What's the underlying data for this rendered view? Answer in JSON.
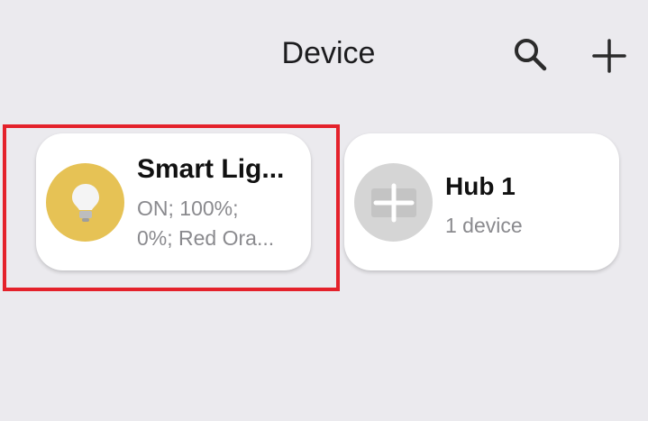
{
  "header": {
    "title": "Device"
  },
  "devices": [
    {
      "name": "Smart Lig...",
      "status_line_1": "ON; 100%;",
      "status_line_2": "0%; Red Ora...",
      "icon": "light-bulb-icon",
      "icon_color": "#e6c255"
    },
    {
      "name": "Hub 1",
      "status_line_1": "1 device",
      "icon": "hub-icon",
      "icon_color": "#d5d5d5"
    }
  ],
  "colors": {
    "background": "#ebeaee",
    "card": "#ffffff",
    "highlight": "#e4222b"
  }
}
